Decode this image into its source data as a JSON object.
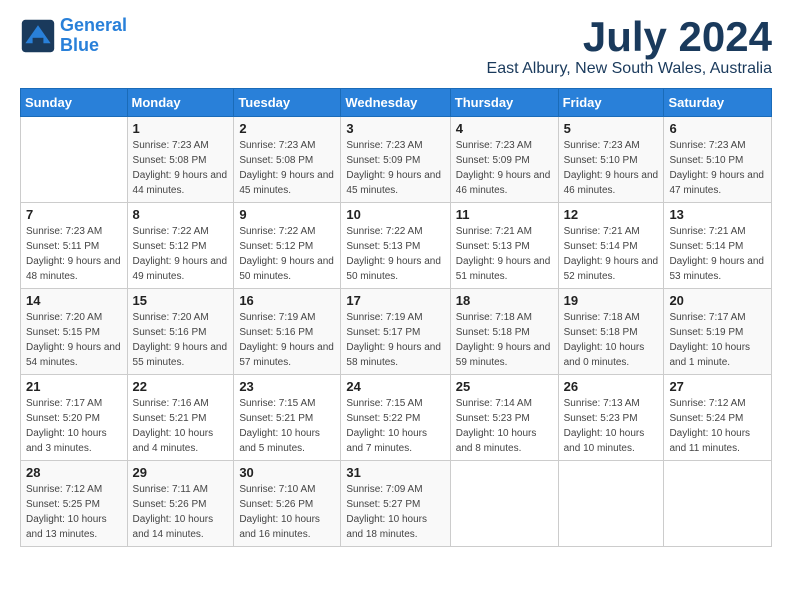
{
  "logo": {
    "line1": "General",
    "line2": "Blue"
  },
  "title": "July 2024",
  "location": "East Albury, New South Wales, Australia",
  "weekdays": [
    "Sunday",
    "Monday",
    "Tuesday",
    "Wednesday",
    "Thursday",
    "Friday",
    "Saturday"
  ],
  "weeks": [
    [
      {
        "day": "",
        "sunrise": "",
        "sunset": "",
        "daylight": ""
      },
      {
        "day": "1",
        "sunrise": "Sunrise: 7:23 AM",
        "sunset": "Sunset: 5:08 PM",
        "daylight": "Daylight: 9 hours and 44 minutes."
      },
      {
        "day": "2",
        "sunrise": "Sunrise: 7:23 AM",
        "sunset": "Sunset: 5:08 PM",
        "daylight": "Daylight: 9 hours and 45 minutes."
      },
      {
        "day": "3",
        "sunrise": "Sunrise: 7:23 AM",
        "sunset": "Sunset: 5:09 PM",
        "daylight": "Daylight: 9 hours and 45 minutes."
      },
      {
        "day": "4",
        "sunrise": "Sunrise: 7:23 AM",
        "sunset": "Sunset: 5:09 PM",
        "daylight": "Daylight: 9 hours and 46 minutes."
      },
      {
        "day": "5",
        "sunrise": "Sunrise: 7:23 AM",
        "sunset": "Sunset: 5:10 PM",
        "daylight": "Daylight: 9 hours and 46 minutes."
      },
      {
        "day": "6",
        "sunrise": "Sunrise: 7:23 AM",
        "sunset": "Sunset: 5:10 PM",
        "daylight": "Daylight: 9 hours and 47 minutes."
      }
    ],
    [
      {
        "day": "7",
        "sunrise": "Sunrise: 7:23 AM",
        "sunset": "Sunset: 5:11 PM",
        "daylight": "Daylight: 9 hours and 48 minutes."
      },
      {
        "day": "8",
        "sunrise": "Sunrise: 7:22 AM",
        "sunset": "Sunset: 5:12 PM",
        "daylight": "Daylight: 9 hours and 49 minutes."
      },
      {
        "day": "9",
        "sunrise": "Sunrise: 7:22 AM",
        "sunset": "Sunset: 5:12 PM",
        "daylight": "Daylight: 9 hours and 50 minutes."
      },
      {
        "day": "10",
        "sunrise": "Sunrise: 7:22 AM",
        "sunset": "Sunset: 5:13 PM",
        "daylight": "Daylight: 9 hours and 50 minutes."
      },
      {
        "day": "11",
        "sunrise": "Sunrise: 7:21 AM",
        "sunset": "Sunset: 5:13 PM",
        "daylight": "Daylight: 9 hours and 51 minutes."
      },
      {
        "day": "12",
        "sunrise": "Sunrise: 7:21 AM",
        "sunset": "Sunset: 5:14 PM",
        "daylight": "Daylight: 9 hours and 52 minutes."
      },
      {
        "day": "13",
        "sunrise": "Sunrise: 7:21 AM",
        "sunset": "Sunset: 5:14 PM",
        "daylight": "Daylight: 9 hours and 53 minutes."
      }
    ],
    [
      {
        "day": "14",
        "sunrise": "Sunrise: 7:20 AM",
        "sunset": "Sunset: 5:15 PM",
        "daylight": "Daylight: 9 hours and 54 minutes."
      },
      {
        "day": "15",
        "sunrise": "Sunrise: 7:20 AM",
        "sunset": "Sunset: 5:16 PM",
        "daylight": "Daylight: 9 hours and 55 minutes."
      },
      {
        "day": "16",
        "sunrise": "Sunrise: 7:19 AM",
        "sunset": "Sunset: 5:16 PM",
        "daylight": "Daylight: 9 hours and 57 minutes."
      },
      {
        "day": "17",
        "sunrise": "Sunrise: 7:19 AM",
        "sunset": "Sunset: 5:17 PM",
        "daylight": "Daylight: 9 hours and 58 minutes."
      },
      {
        "day": "18",
        "sunrise": "Sunrise: 7:18 AM",
        "sunset": "Sunset: 5:18 PM",
        "daylight": "Daylight: 9 hours and 59 minutes."
      },
      {
        "day": "19",
        "sunrise": "Sunrise: 7:18 AM",
        "sunset": "Sunset: 5:18 PM",
        "daylight": "Daylight: 10 hours and 0 minutes."
      },
      {
        "day": "20",
        "sunrise": "Sunrise: 7:17 AM",
        "sunset": "Sunset: 5:19 PM",
        "daylight": "Daylight: 10 hours and 1 minute."
      }
    ],
    [
      {
        "day": "21",
        "sunrise": "Sunrise: 7:17 AM",
        "sunset": "Sunset: 5:20 PM",
        "daylight": "Daylight: 10 hours and 3 minutes."
      },
      {
        "day": "22",
        "sunrise": "Sunrise: 7:16 AM",
        "sunset": "Sunset: 5:21 PM",
        "daylight": "Daylight: 10 hours and 4 minutes."
      },
      {
        "day": "23",
        "sunrise": "Sunrise: 7:15 AM",
        "sunset": "Sunset: 5:21 PM",
        "daylight": "Daylight: 10 hours and 5 minutes."
      },
      {
        "day": "24",
        "sunrise": "Sunrise: 7:15 AM",
        "sunset": "Sunset: 5:22 PM",
        "daylight": "Daylight: 10 hours and 7 minutes."
      },
      {
        "day": "25",
        "sunrise": "Sunrise: 7:14 AM",
        "sunset": "Sunset: 5:23 PM",
        "daylight": "Daylight: 10 hours and 8 minutes."
      },
      {
        "day": "26",
        "sunrise": "Sunrise: 7:13 AM",
        "sunset": "Sunset: 5:23 PM",
        "daylight": "Daylight: 10 hours and 10 minutes."
      },
      {
        "day": "27",
        "sunrise": "Sunrise: 7:12 AM",
        "sunset": "Sunset: 5:24 PM",
        "daylight": "Daylight: 10 hours and 11 minutes."
      }
    ],
    [
      {
        "day": "28",
        "sunrise": "Sunrise: 7:12 AM",
        "sunset": "Sunset: 5:25 PM",
        "daylight": "Daylight: 10 hours and 13 minutes."
      },
      {
        "day": "29",
        "sunrise": "Sunrise: 7:11 AM",
        "sunset": "Sunset: 5:26 PM",
        "daylight": "Daylight: 10 hours and 14 minutes."
      },
      {
        "day": "30",
        "sunrise": "Sunrise: 7:10 AM",
        "sunset": "Sunset: 5:26 PM",
        "daylight": "Daylight: 10 hours and 16 minutes."
      },
      {
        "day": "31",
        "sunrise": "Sunrise: 7:09 AM",
        "sunset": "Sunset: 5:27 PM",
        "daylight": "Daylight: 10 hours and 18 minutes."
      },
      {
        "day": "",
        "sunrise": "",
        "sunset": "",
        "daylight": ""
      },
      {
        "day": "",
        "sunrise": "",
        "sunset": "",
        "daylight": ""
      },
      {
        "day": "",
        "sunrise": "",
        "sunset": "",
        "daylight": ""
      }
    ]
  ]
}
